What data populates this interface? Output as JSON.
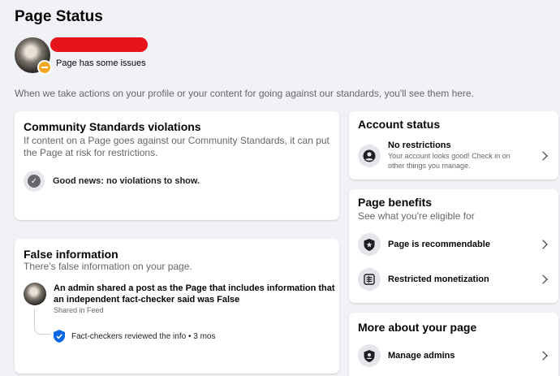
{
  "page": {
    "title": "Page Status",
    "profile_status": "Page has some issues",
    "intro": "When we take actions on your profile or your content for going against our standards, you'll see them here."
  },
  "community_standards": {
    "title": "Community Standards violations",
    "description": "If content on a Page goes against our Community Standards, it can put the Page at risk for restrictions.",
    "good_news": "Good news: no violations to show."
  },
  "false_information": {
    "title": "False information",
    "description": "There's false information on your page.",
    "item_text": "An admin shared a post as the Page that includes information that an independent fact-checker said was False",
    "item_meta": "Shared in Feed",
    "fact_check": "Fact-checkers reviewed the info • 3 mos"
  },
  "account_status": {
    "title": "Account status",
    "item_title": "No restrictions",
    "item_desc": "Your account looks good! Check in on other things you manage."
  },
  "page_benefits": {
    "title": "Page benefits",
    "description": "See what you're eligible for",
    "items": [
      {
        "label": "Page is recommendable",
        "icon": "shield-star-icon"
      },
      {
        "label": "Restricted monetization",
        "icon": "monetization-icon"
      }
    ]
  },
  "more_about": {
    "title": "More about your page",
    "items": [
      {
        "label": "Manage admins",
        "icon": "admin-shield-icon"
      }
    ]
  },
  "colors": {
    "background": "#f0f2f5",
    "badge": "#f7a823",
    "redaction": "#e8141c",
    "fact_check_blue": "#0a66e4"
  }
}
